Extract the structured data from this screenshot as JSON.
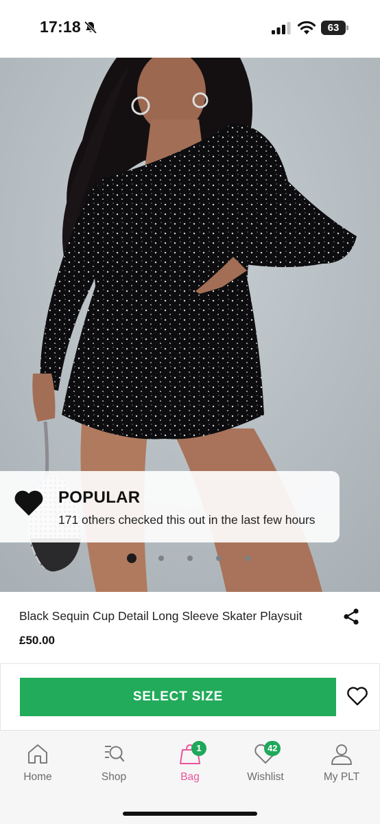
{
  "status_bar": {
    "time": "17:18",
    "battery": "63",
    "icons": [
      "bell-slash-icon",
      "signal-icon",
      "wifi-icon",
      "battery-icon"
    ]
  },
  "product": {
    "image_icon": "sequin-playsuit-photo",
    "popular": {
      "title": "POPULAR",
      "text": "171 others checked this out in the last few hours",
      "icon": "heart-filled-icon"
    },
    "carousel": {
      "total": 5,
      "current": 1
    },
    "name": "Black Sequin Cup Detail Long Sleeve Skater Playsuit",
    "price": "£50.00",
    "share_icon": "share-icon"
  },
  "actions": {
    "select_size_label": "SELECT SIZE",
    "wishlist_icon": "heart-outline-icon",
    "accent_color": "#22ab5a"
  },
  "tab_bar": {
    "tabs": [
      {
        "label": "Home",
        "icon": "home-icon"
      },
      {
        "label": "Shop",
        "icon": "search-icon"
      },
      {
        "label": "Bag",
        "icon": "bag-icon",
        "badge": "1"
      },
      {
        "label": "Wishlist",
        "icon": "heart-icon",
        "badge": "42"
      },
      {
        "label": "My PLT",
        "icon": "user-icon"
      }
    ],
    "active": "Bag",
    "active_color": "#e9559a"
  }
}
